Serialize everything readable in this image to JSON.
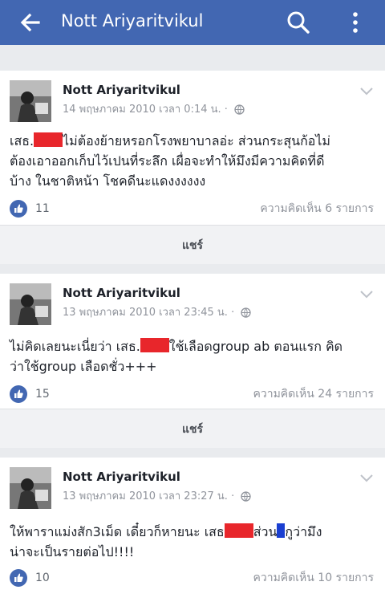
{
  "header": {
    "title": "Nott Ariyaritvikul",
    "back_icon": "arrow-left-icon",
    "search_icon": "search-icon",
    "menu_icon": "more-vertical-icon"
  },
  "posts": [
    {
      "author": "Nott Ariyaritvikul",
      "timestamp": "14 พฤษภาคม 2010 เวลา 0:14 น.",
      "text_lines": [
        {
          "before": "เสธ.",
          "redact": "red",
          "after": "ไม่ต้องย้ายหรอกโรงพยาบาลอ่ะ ส่วนกระสุนก้อไม่"
        },
        {
          "before": "ต้องเอาออกเก็บไว้เปนที่ระลึก เผื่อจะทำให้มึงมีความคิดที่ดี"
        },
        {
          "before": "บ้าง ในชาติหน้า โชคดีนะแดงงงงงง"
        }
      ],
      "likes": "11",
      "comments": "ความคิดเห็น 6 รายการ",
      "share": "แชร์"
    },
    {
      "author": "Nott Ariyaritvikul",
      "timestamp": "13 พฤษภาคม 2010 เวลา 23:45 น.",
      "text_lines": [
        {
          "before": "ไม่คิดเลยนะเนี่ยว่า เสธ.",
          "redact": "red",
          "after": "ใช้เลือดgroup ab ตอนแรก คิด"
        },
        {
          "before": "ว่าใช้group เลือดชั่ว+++"
        }
      ],
      "likes": "15",
      "comments": "ความคิดเห็น 24 รายการ",
      "share": "แชร์"
    },
    {
      "author": "Nott Ariyaritvikul",
      "timestamp": "13 พฤษภาคม 2010 เวลา 23:27 น.",
      "text_lines": [
        {
          "before": "ให้พาราแม่งสัก3เม็ด เดี๋ยวก็หายนะ เสธ",
          "redact": "red",
          "after": "ส่วน",
          "redact2": "blue",
          "after2": "กูว่ามึง"
        },
        {
          "before": "น่าจะเป็นรายต่อไป!!!!"
        }
      ],
      "likes": "10",
      "comments": "ความคิดเห็น 10 รายการ"
    }
  ],
  "colors": {
    "header": "#4267b2",
    "redaction": "#e8262b",
    "redaction_blue": "#1a3fd1",
    "like": "#4267b2"
  }
}
